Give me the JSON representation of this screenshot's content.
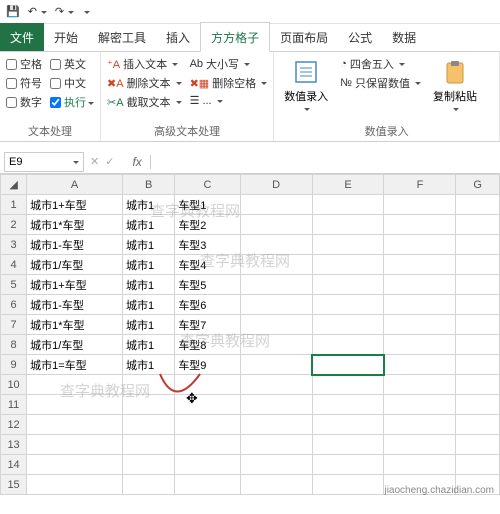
{
  "qat": {
    "save": "💾",
    "undo": "↶",
    "redo": "↷",
    "more": "▾"
  },
  "tabs": {
    "file": "文件",
    "start": "开始",
    "tools": "解密工具",
    "insert": "插入",
    "fgz": "方方格子",
    "layout": "页面布局",
    "formula": "公式",
    "data": "数据"
  },
  "ribbon": {
    "text_proc": {
      "label": "文本处理",
      "blank": "空格",
      "english": "英文",
      "symbol": "符号",
      "chinese": "中文",
      "number": "数字",
      "exec": "执行"
    },
    "adv_text": {
      "label": "高级文本处理",
      "insert_text": "插入文本",
      "del_text": "删除文本",
      "clip_text": "截取文本",
      "case": "大小写",
      "del_blank": "删除空格",
      "more": "..."
    },
    "num_rec": {
      "label": "数值录入",
      "numrec": "数值录入",
      "round": "四舍五入",
      "keepnum": "只保留数值",
      "copypaste": "复制粘贴"
    }
  },
  "namebox": "E9",
  "cols": [
    "A",
    "B",
    "C",
    "D",
    "E",
    "F",
    "G"
  ],
  "rows": [
    {
      "n": "1",
      "a": "城市1+车型",
      "b": "城市1",
      "c": "车型1"
    },
    {
      "n": "2",
      "a": "城市1*车型",
      "b": "城市1",
      "c": "车型2"
    },
    {
      "n": "3",
      "a": "城市1-车型",
      "b": "城市1",
      "c": "车型3"
    },
    {
      "n": "4",
      "a": "城市1/车型",
      "b": "城市1",
      "c": "车型4"
    },
    {
      "n": "5",
      "a": "城市1+车型",
      "b": "城市1",
      "c": "车型5"
    },
    {
      "n": "6",
      "a": "城市1-车型",
      "b": "城市1",
      "c": "车型6"
    },
    {
      "n": "7",
      "a": "城市1*车型",
      "b": "城市1",
      "c": "车型7"
    },
    {
      "n": "8",
      "a": "城市1/车型",
      "b": "城市1",
      "c": "车型8"
    },
    {
      "n": "9",
      "a": "城市1=车型",
      "b": "城市1",
      "c": "车型9"
    },
    {
      "n": "10"
    },
    {
      "n": "11"
    },
    {
      "n": "12"
    },
    {
      "n": "13"
    },
    {
      "n": "14"
    },
    {
      "n": "15"
    }
  ],
  "watermark": "查字典教程网",
  "footer": "jiaocheng.chazidian.com"
}
